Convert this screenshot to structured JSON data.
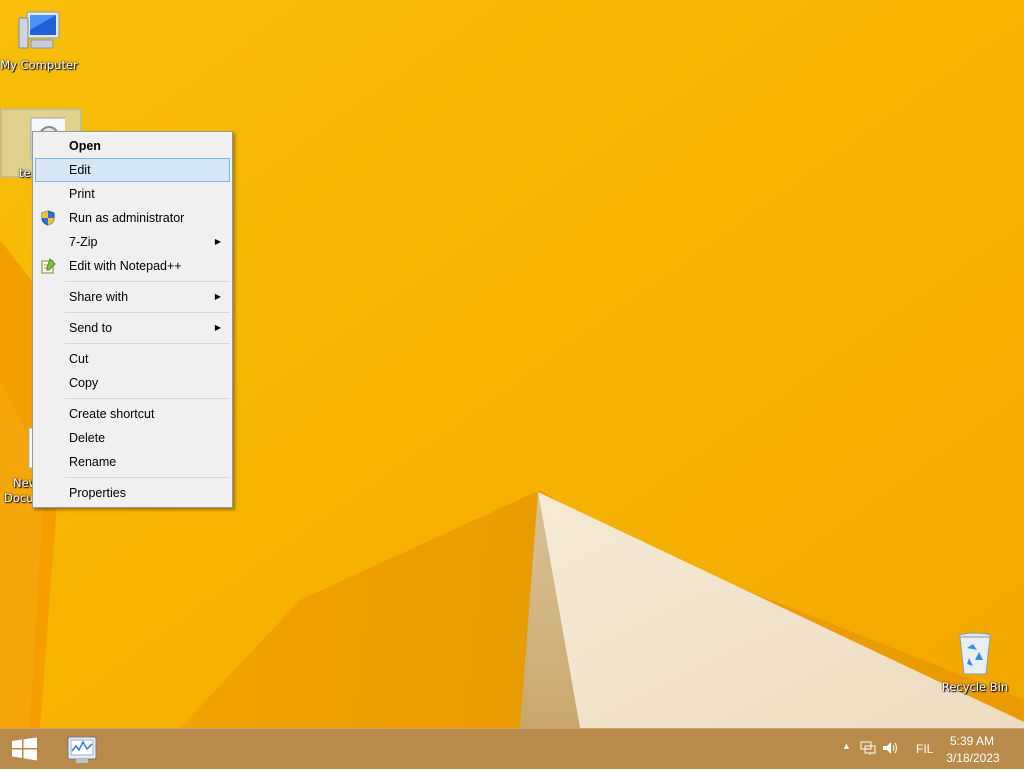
{
  "desktop": {
    "icons": [
      {
        "label": "My Computer",
        "icon": "computer-icon"
      },
      {
        "label": "te",
        "icon": "settings-file-icon",
        "selected": true
      },
      {
        "label": "New Text Document.txt",
        "icon": "text-file-icon"
      },
      {
        "label": "Recycle Bin",
        "icon": "recycle-bin-icon"
      }
    ]
  },
  "context_menu": {
    "items": [
      {
        "label": "Open",
        "bold": true
      },
      {
        "label": "Edit",
        "highlighted": true
      },
      {
        "label": "Print"
      },
      {
        "label": "Run as administrator",
        "icon": "uac-shield-icon"
      },
      {
        "label": "7-Zip",
        "submenu": true
      },
      {
        "label": "Edit with Notepad++",
        "icon": "notepad-plus-plus-icon"
      },
      {
        "label": "Share with",
        "submenu": true
      },
      {
        "label": "Send to",
        "submenu": true
      },
      {
        "label": "Cut"
      },
      {
        "label": "Copy"
      },
      {
        "label": "Create shortcut"
      },
      {
        "label": "Delete"
      },
      {
        "label": "Rename"
      },
      {
        "label": "Properties"
      }
    ],
    "submenu_arrow": "▶"
  },
  "taskbar": {
    "start_icon": "windows-logo-icon",
    "pinned_app_icon": "performance-monitor-icon",
    "tray": {
      "show_hidden_arrow": "▲",
      "language": "FIL",
      "time": "5:39 AM",
      "date": "3/18/2023"
    }
  },
  "colors": {
    "wallpaper_main": "#f6b400",
    "wallpaper_light": "#f1e3c8",
    "menu_background": "#f0f0f0",
    "menu_highlight": "#d5e6f7",
    "taskbar": "#b88b4a"
  }
}
